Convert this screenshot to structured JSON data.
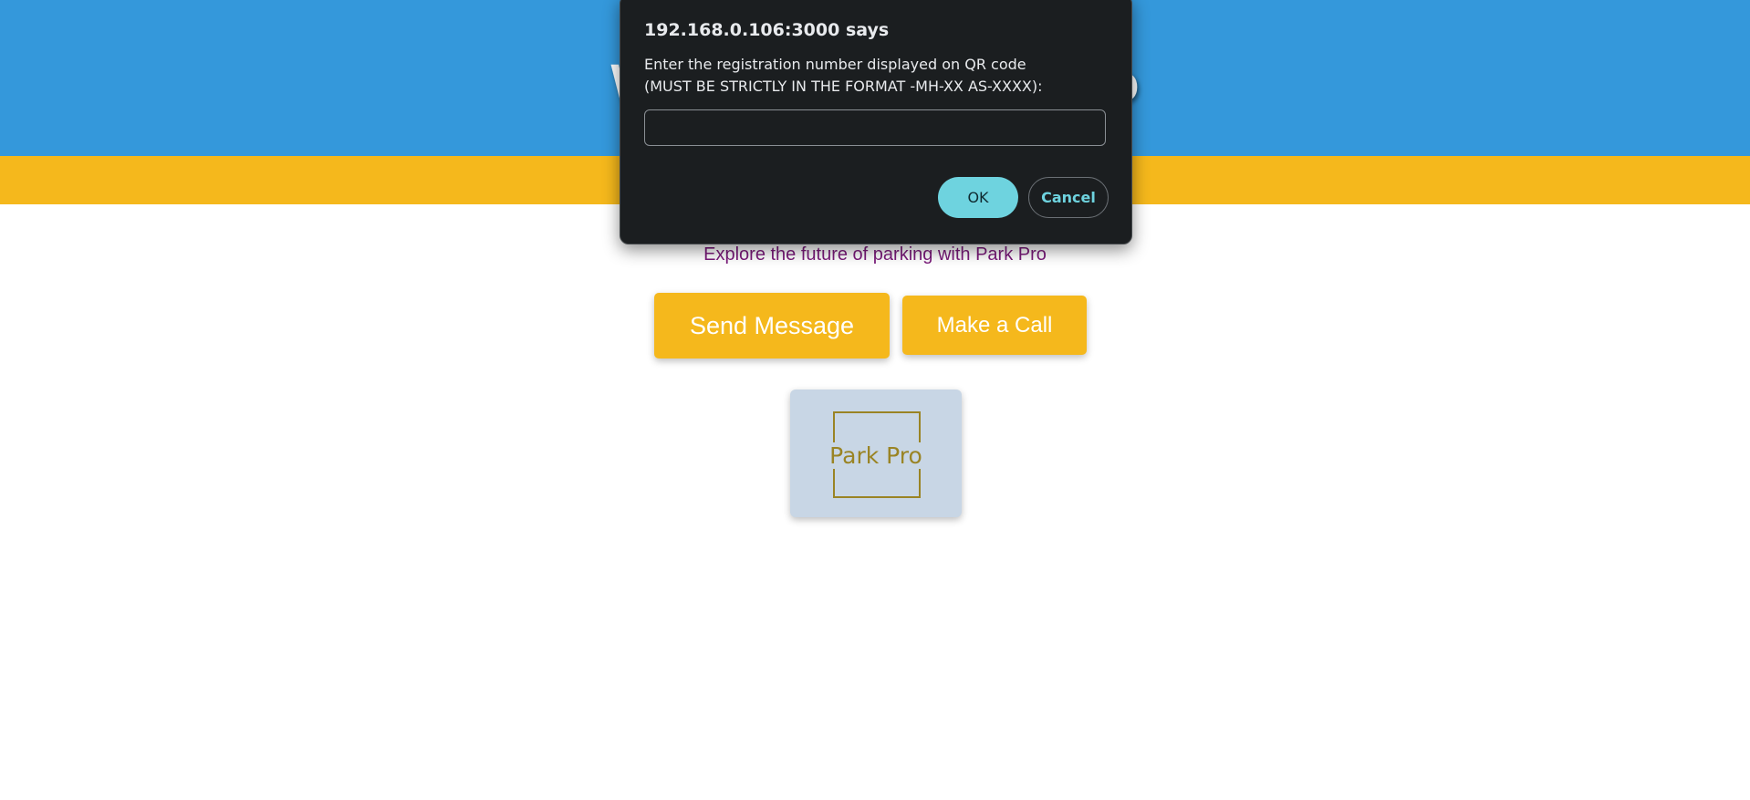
{
  "header": {
    "title": "Welcome to Park Pro",
    "background": "#3498db",
    "stripe_color": "#f5b81c"
  },
  "main": {
    "tagline": "Explore the future of parking with Park Pro",
    "send_button": "Send Message",
    "call_button": "Make a Call",
    "logo_text": "Park Pro",
    "accent": "#f5b81c"
  },
  "dialog": {
    "title": "192.168.0.106:3000 says",
    "message_line1": "Enter the registration number displayed on QR code",
    "message_line2": "(MUST BE STRICTLY IN THE FORMAT -MH-XX AS-XXXX):",
    "input_value": "",
    "ok_label": "OK",
    "cancel_label": "Cancel"
  }
}
